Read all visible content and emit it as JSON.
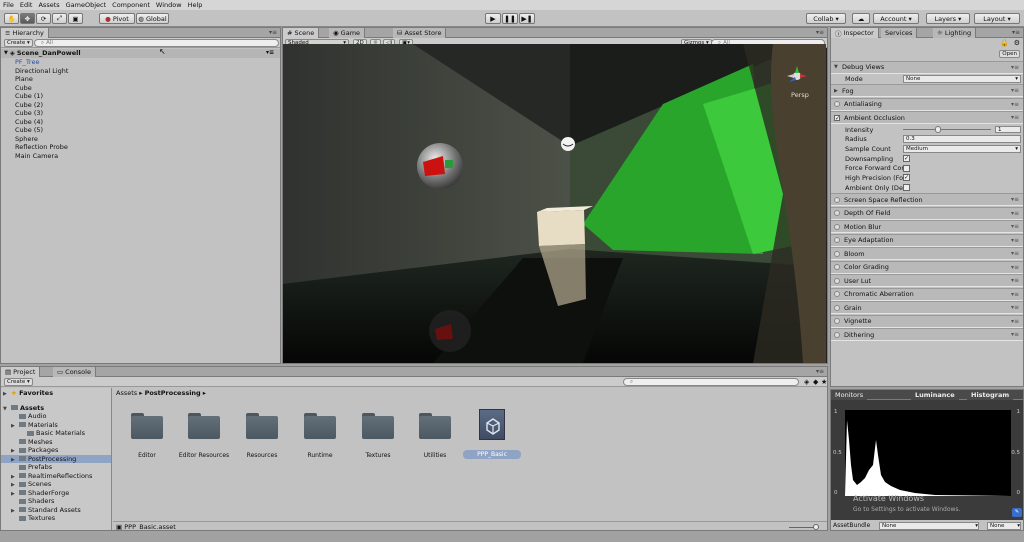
{
  "menu": [
    "File",
    "Edit",
    "Assets",
    "GameObject",
    "Component",
    "Window",
    "Help"
  ],
  "toolbar": {
    "pivot": "Pivot",
    "global": "Global",
    "collab": "Collab",
    "account": "Account",
    "layers": "Layers",
    "layout": "Layout"
  },
  "hierarchy": {
    "tab": "Hierarchy",
    "create": "Create",
    "search_placeholder": "All",
    "scene": "Scene_DanPowell",
    "items": [
      "PF_Tree",
      "Directional Light",
      "Plane",
      "Cube",
      "Cube (1)",
      "Cube (2)",
      "Cube (3)",
      "Cube (4)",
      "Cube (5)",
      "Sphere",
      "Reflection Probe",
      "Main Camera"
    ]
  },
  "scene": {
    "tabs": [
      "Scene",
      "Game",
      "Asset Store"
    ],
    "shading": "Shaded",
    "mode2d": "2D",
    "gizmos": "Gizmos",
    "search_placeholder": "All",
    "persp": "Persp"
  },
  "inspector": {
    "tabs": [
      "Inspector",
      "Services",
      "Lighting"
    ],
    "open": "Open",
    "debug_views": "Debug Views",
    "mode_label": "Mode",
    "mode_value": "None",
    "fog": "Fog",
    "antialiasing": "Antialiasing",
    "ambient_occlusion": "Ambient Occlusion",
    "ao": {
      "intensity_label": "Intensity",
      "intensity_value": "1",
      "intensity_fraction": 0.4,
      "radius_label": "Radius",
      "radius_value": "0.3",
      "sample_label": "Sample Count",
      "sample_value": "Medium",
      "downsampling": "Downsampling",
      "force_forward": "Force Forward Con",
      "high_precision": "High Precision (For",
      "ambient_only": "Ambient Only (Def"
    },
    "sections": [
      "Screen Space Reflection",
      "Depth Of Field",
      "Motion Blur",
      "Eye Adaptation",
      "Bloom",
      "Color Grading",
      "User Lut",
      "Chromatic Aberration",
      "Grain",
      "Vignette",
      "Dithering"
    ]
  },
  "project": {
    "tabs": [
      "Project",
      "Console"
    ],
    "create": "Create",
    "favorites": "Favorites",
    "assets": "Assets",
    "tree": [
      {
        "label": "Audio",
        "depth": 1,
        "arrow": false
      },
      {
        "label": "Materials",
        "depth": 1,
        "arrow": true
      },
      {
        "label": "Basic Materials",
        "depth": 2,
        "arrow": false
      },
      {
        "label": "Meshes",
        "depth": 1,
        "arrow": false
      },
      {
        "label": "Packages",
        "depth": 1,
        "arrow": true
      },
      {
        "label": "PostProcessing",
        "depth": 1,
        "arrow": true
      },
      {
        "label": "Prefabs",
        "depth": 1,
        "arrow": false
      },
      {
        "label": "RealtimeReflections",
        "depth": 1,
        "arrow": true
      },
      {
        "label": "Scenes",
        "depth": 1,
        "arrow": true
      },
      {
        "label": "ShaderForge",
        "depth": 1,
        "arrow": true
      },
      {
        "label": "Shaders",
        "depth": 1,
        "arrow": false
      },
      {
        "label": "Standard Assets",
        "depth": 1,
        "arrow": true
      },
      {
        "label": "Textures",
        "depth": 1,
        "arrow": false
      }
    ],
    "breadcrumb_root": "Assets",
    "breadcrumb_current": "PostProcessing",
    "folders": [
      "Editor",
      "Editor Resources",
      "Resources",
      "Runtime",
      "Textures",
      "Utilities"
    ],
    "asset": "PPP_Basic",
    "status_file": "PPP_Basic.asset"
  },
  "monitors": {
    "title": "Monitors",
    "luminance": "Luminance",
    "histogram": "Histogram",
    "y_labels": [
      "1",
      "0.5",
      "0"
    ],
    "watermark1": "Activate Windows",
    "watermark2": "Go to Settings to activate Windows.",
    "assetbundle_label": "AssetBundle",
    "assetbundle_value": "None",
    "variant_value": "None"
  },
  "colors": {
    "selected_blue": "#2b4fa8",
    "selection_bg": "#8fa4c4",
    "panel": "#c2c2c2"
  }
}
